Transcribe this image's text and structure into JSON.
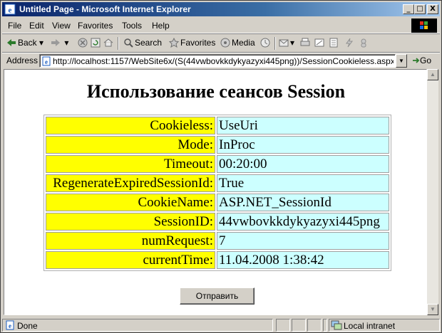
{
  "window": {
    "title": "Untitled Page - Microsoft Internet Explorer",
    "minimize": "_",
    "maximize": "□",
    "close": "X"
  },
  "menu": [
    "File",
    "Edit",
    "View",
    "Favorites",
    "Tools",
    "Help"
  ],
  "toolbar": {
    "back": "Back",
    "search": "Search",
    "favorites": "Favorites",
    "media": "Media"
  },
  "address": {
    "label": "Address",
    "url": "http://localhost:1157/WebSite6x/(S(44vwbovkkdykyazyxi445png))/SessionCookieless.aspx",
    "go": "Go"
  },
  "page": {
    "heading": "Использование сеансов Session",
    "rows": [
      {
        "key": "Cookieless:",
        "value": "UseUri"
      },
      {
        "key": "Mode:",
        "value": "InProc"
      },
      {
        "key": "Timeout:",
        "value": "00:20:00"
      },
      {
        "key": "RegenerateExpiredSessionId:",
        "value": "True"
      },
      {
        "key": "CookieName:",
        "value": "ASP.NET_SessionId"
      },
      {
        "key": "SessionID:",
        "value": "44vwbovkkdykyazyxi445png"
      },
      {
        "key": "numRequest:",
        "value": "7"
      },
      {
        "key": "currentTime:",
        "value": "11.04.2008 1:38:42"
      }
    ],
    "submit": "Отправить"
  },
  "status": {
    "text": "Done",
    "zone": "Local intranet"
  },
  "colors": {
    "key_bg": "#ffff00",
    "value_bg": "#ccffff",
    "titlebar": "#0a246a"
  }
}
